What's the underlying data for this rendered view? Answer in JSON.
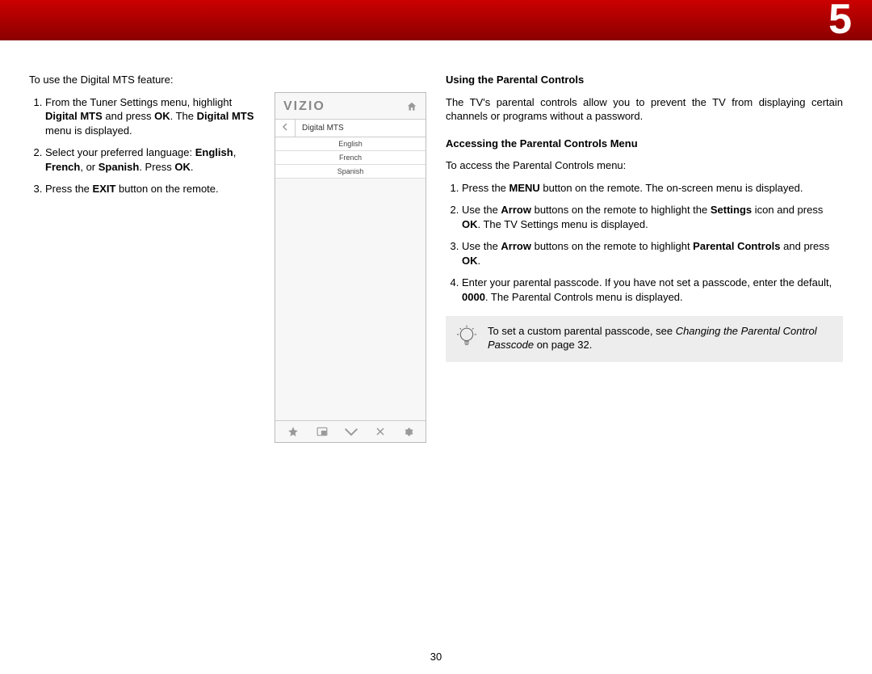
{
  "chapter_number": "5",
  "page_number": "30",
  "left": {
    "intro": "To use the Digital MTS feature:",
    "steps": [
      {
        "pre": "From the Tuner Settings menu, highlight ",
        "b1": "Digital MTS",
        "mid1": " and press ",
        "b2": "OK",
        "mid2": ". The ",
        "b3": "Digital MTS",
        "post": " menu is displayed."
      },
      {
        "pre": "Select your preferred language: ",
        "b1": "English",
        "mid1": ", ",
        "b2": "French",
        "mid2": ", or ",
        "b3": "Spanish",
        "mid3": ". Press ",
        "b4": "OK",
        "post": "."
      },
      {
        "pre": "Press the ",
        "b1": "EXIT",
        "post": " button on the remote."
      }
    ],
    "menu": {
      "brand": "VIZIO",
      "title": "Digital MTS",
      "items": [
        "English",
        "French",
        "Spanish"
      ]
    }
  },
  "right": {
    "h1": "Using the Parental Controls",
    "p1": "The TV's parental controls allow you to prevent the TV from displaying certain channels or programs without a password.",
    "h2": "Accessing the Parental Controls Menu",
    "p2": "To access the Parental Controls menu:",
    "steps": [
      {
        "pre": "Press the ",
        "b1": "MENU",
        "post": " button on the remote. The on-screen menu is displayed."
      },
      {
        "pre": "Use the ",
        "b1": "Arrow",
        "mid1": " buttons on the remote to highlight the ",
        "b2": "Settings",
        "mid2": " icon and press ",
        "b3": "OK",
        "post": ". The TV Settings menu is displayed."
      },
      {
        "pre": "Use the ",
        "b1": "Arrow",
        "mid1": " buttons on the remote to highlight ",
        "b2": "Parental Controls",
        "mid2": " and press ",
        "b3": "OK",
        "post": "."
      },
      {
        "pre": "Enter your parental passcode. If you have not set a passcode, enter the default, ",
        "b1": "0000",
        "post": ". The Parental Controls menu is displayed."
      }
    ],
    "tip_pre": "To set a custom parental passcode, see ",
    "tip_em": "Changing the Parental Control Passcode",
    "tip_post": " on page 32."
  }
}
